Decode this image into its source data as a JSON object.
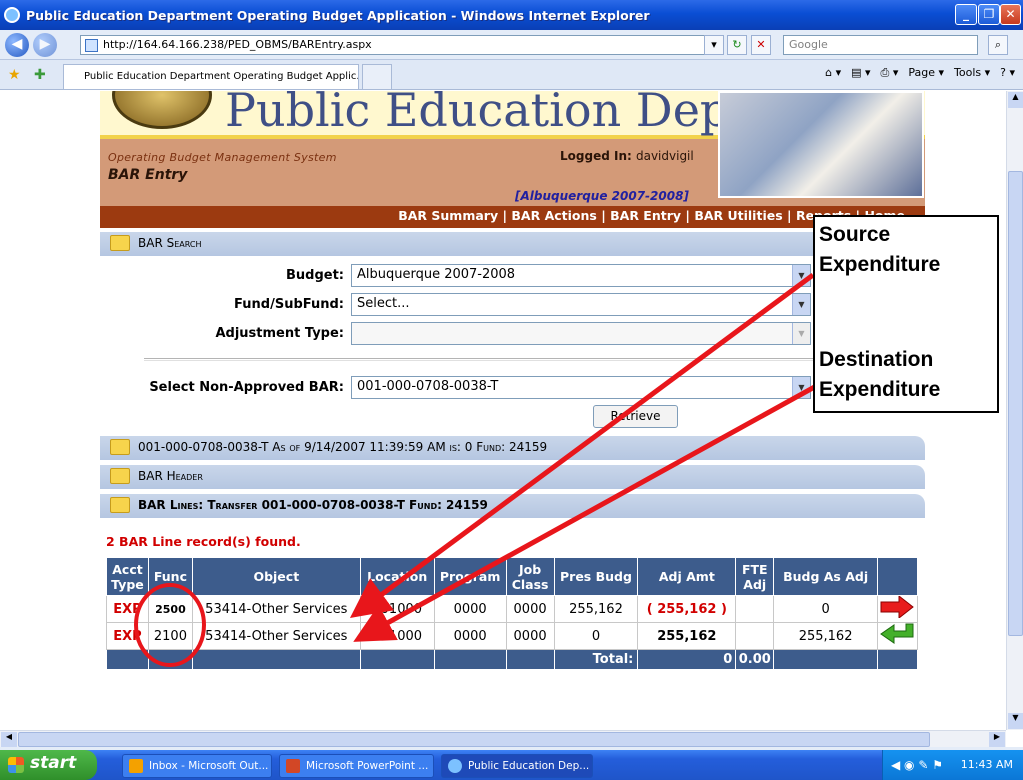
{
  "window": {
    "title": "Public Education Department Operating Budget Application - Windows Internet Explorer"
  },
  "browser": {
    "url": "http://164.64.166.238/PED_OBMS/BAREntry.aspx",
    "search_placeholder": "Google",
    "tab_title": "Public Education Department Operating Budget Applic...",
    "commands": [
      "Page ▾",
      "Tools ▾"
    ]
  },
  "header": {
    "dept_title": "Public Education Department",
    "system_name": "Operating Budget Management System",
    "page_name": "BAR Entry",
    "logged_in_label": "Logged In:",
    "logged_in_user": "davidvigil",
    "district": "[Albuquerque 2007-2008]"
  },
  "menu": {
    "items": [
      "BAR Summary",
      "BAR Actions",
      "BAR Entry",
      "BAR Utilities",
      "Reports",
      "Home"
    ]
  },
  "search": {
    "section_title": "BAR Search",
    "budget_label": "Budget:",
    "budget_value": "Albuquerque 2007-2008",
    "fund_label": "Fund/SubFund:",
    "fund_value": "Select...",
    "adjustment_label": "Adjustment Type:",
    "adjustment_value": "",
    "bar_label": "Select Non-Approved BAR:",
    "bar_value": "001-000-0708-0038-T",
    "retrieve_label": "Retrieve"
  },
  "bar_info": {
    "text": "001-000-0708-0038-T As of 9/14/2007 11:39:59 AM is: 0   Fund: 24159"
  },
  "bar_header": {
    "title": "BAR Header"
  },
  "bar_lines": {
    "title": "BAR Lines: Transfer   001-000-0708-0038-T   Fund: 24159",
    "records_found": "2 BAR Line record(s) found.",
    "columns": [
      "Acct Type",
      "Func",
      "Object",
      "Location",
      "Program",
      "Job Class",
      "Pres Budg",
      "Adj Amt",
      "FTE Adj",
      "Budg As Adj",
      ""
    ],
    "rows": [
      {
        "acct_type": "EXP",
        "func": "2500",
        "object": "53414-Other Services",
        "location": "001000",
        "program": "0000",
        "job_class": "0000",
        "pres_budg": "255,162",
        "adj_amt": "( 255,162 )",
        "fte_adj": "",
        "budg_as_adj": "0",
        "icon": "red-arrow-right-icon"
      },
      {
        "acct_type": "EXP",
        "func": "2100",
        "object": "53414-Other Services",
        "location": "001000",
        "program": "0000",
        "job_class": "0000",
        "pres_budg": "0",
        "adj_amt": "255,162",
        "fte_adj": "",
        "budg_as_adj": "255,162",
        "icon": "green-arrow-return-icon"
      }
    ],
    "total_label": "Total:",
    "total_adj": "0",
    "total_fte": "0.00"
  },
  "annotations": {
    "source": "Source Expenditure",
    "destination": "Destination Expenditure",
    "color": "#e8161b"
  },
  "taskbar": {
    "start_label": "start",
    "tasks": [
      "Inbox - Microsoft Out...",
      "Microsoft PowerPoint ...",
      "Public Education Dep..."
    ],
    "clock": "11:43 AM"
  }
}
